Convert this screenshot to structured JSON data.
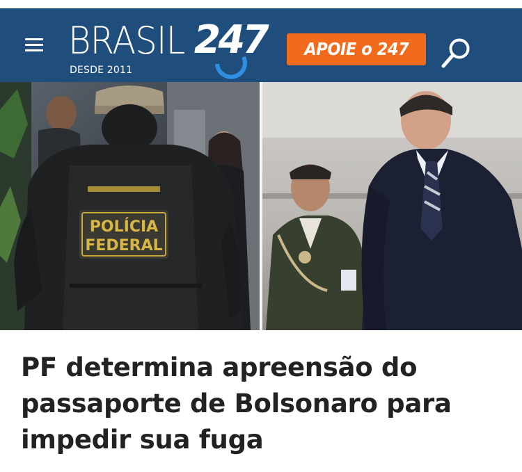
{
  "header": {
    "logo_word": "BRASIL",
    "logo_number": "247",
    "logo_tagline": "DESDE 2011",
    "support_label": "APOIE o 247",
    "background_color": "#1f4e7d",
    "accent_color": "#f26a1b",
    "menu_icon": "hamburger-menu-icon",
    "search_icon": "search-icon"
  },
  "photo": {
    "left_vest_text_line1": "POLÍCIA",
    "left_vest_text_line2": "FEDERAL"
  },
  "article": {
    "headline": "PF determina apreensão do passaporte de Bolsonaro para impedir sua fuga"
  }
}
